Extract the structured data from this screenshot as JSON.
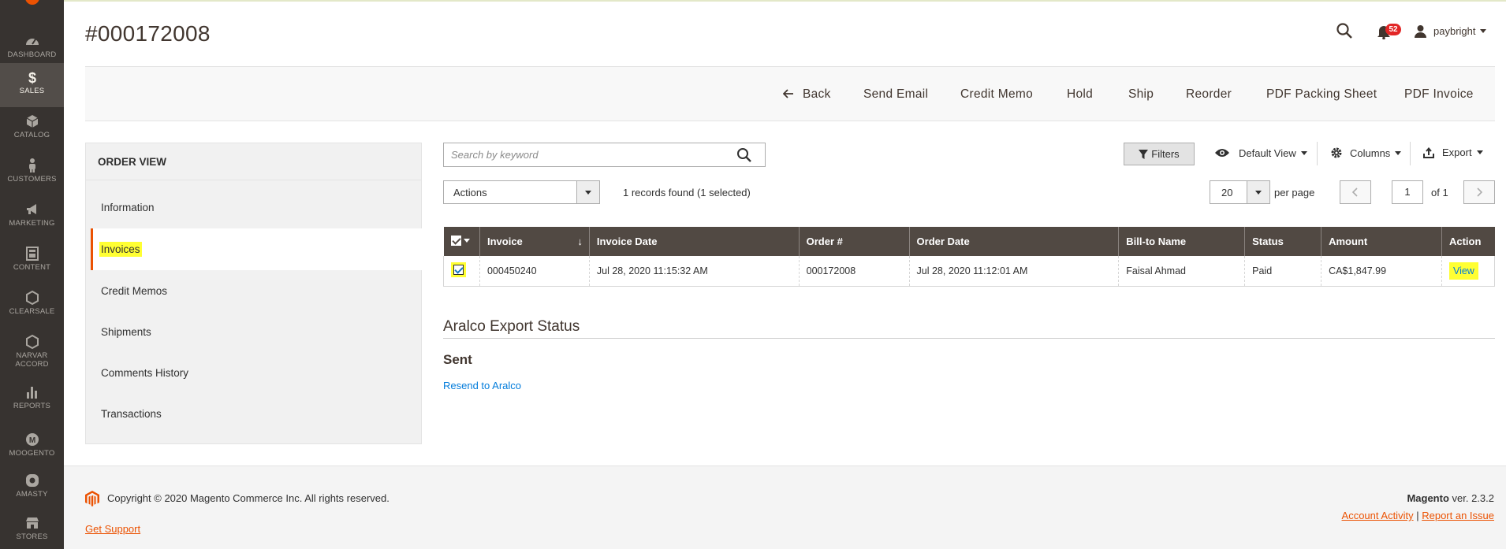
{
  "page": {
    "title": "#000172008"
  },
  "header": {
    "notifications_count": "52",
    "user_name": "paybright"
  },
  "sidebar": {
    "items": [
      {
        "label": "Dashboard",
        "icon": "dashboard-icon"
      },
      {
        "label": "Sales",
        "icon": "dollar-icon",
        "active": true
      },
      {
        "label": "Catalog",
        "icon": "box-icon"
      },
      {
        "label": "Customers",
        "icon": "person-icon"
      },
      {
        "label": "Marketing",
        "icon": "megaphone-icon"
      },
      {
        "label": "Content",
        "icon": "layout-icon"
      },
      {
        "label": "Clearsale",
        "icon": "hexagon-icon"
      },
      {
        "label": "Narvar Accord",
        "icon": "hexagon-icon"
      },
      {
        "label": "Reports",
        "icon": "bar-chart-icon"
      },
      {
        "label": "Moogento",
        "icon": "moogento-icon"
      },
      {
        "label": "Amasty",
        "icon": "amasty-icon"
      },
      {
        "label": "Stores",
        "icon": "store-icon"
      }
    ]
  },
  "action_bar": {
    "back": "Back",
    "send_email": "Send Email",
    "credit_memo": "Credit Memo",
    "hold": "Hold",
    "ship": "Ship",
    "reorder": "Reorder",
    "pdf_packing_sheet": "PDF Packing Sheet",
    "pdf_invoice": "PDF Invoice"
  },
  "order_view": {
    "title": "Order View",
    "tabs": [
      "Information",
      "Invoices",
      "Credit Memos",
      "Shipments",
      "Comments History",
      "Transactions"
    ],
    "active_tab": "Invoices"
  },
  "grid_toolbar": {
    "search_placeholder": "Search by keyword",
    "filters": "Filters",
    "view": "Default View",
    "columns": "Columns",
    "export": "Export",
    "actions": "Actions",
    "records": "1 records found (1 selected)",
    "per_page_value": "20",
    "per_page_label": "per page",
    "page_current": "1",
    "page_of": "of 1"
  },
  "grid": {
    "columns": [
      "Invoice",
      "Invoice Date",
      "Order #",
      "Order Date",
      "Bill-to Name",
      "Status",
      "Amount",
      "Action"
    ],
    "rows": [
      {
        "invoice": "000450240",
        "invoice_date": "Jul 28, 2020 11:15:32 AM",
        "order": "000172008",
        "order_date": "Jul 28, 2020 11:12:01 AM",
        "bill_to": "Faisal Ahmad",
        "status": "Paid",
        "amount": "CA$1,847.99",
        "action": "View"
      }
    ]
  },
  "aralco": {
    "title": "Aralco Export Status",
    "status": "Sent",
    "resend": "Resend to Aralco"
  },
  "footer": {
    "copyright": "Copyright © 2020 Magento Commerce Inc. All rights reserved.",
    "support": "Get Support",
    "brand": "Magento",
    "version": "ver. 2.3.2",
    "account_activity": "Account Activity",
    "link_sep": "|",
    "report_issue": "Report an Issue"
  },
  "colors": {
    "accent": "#eb5202",
    "sidebar_bg": "#373330",
    "grid_header_bg": "#514943",
    "highlight": "#ffff33",
    "link": "#007bdb"
  }
}
